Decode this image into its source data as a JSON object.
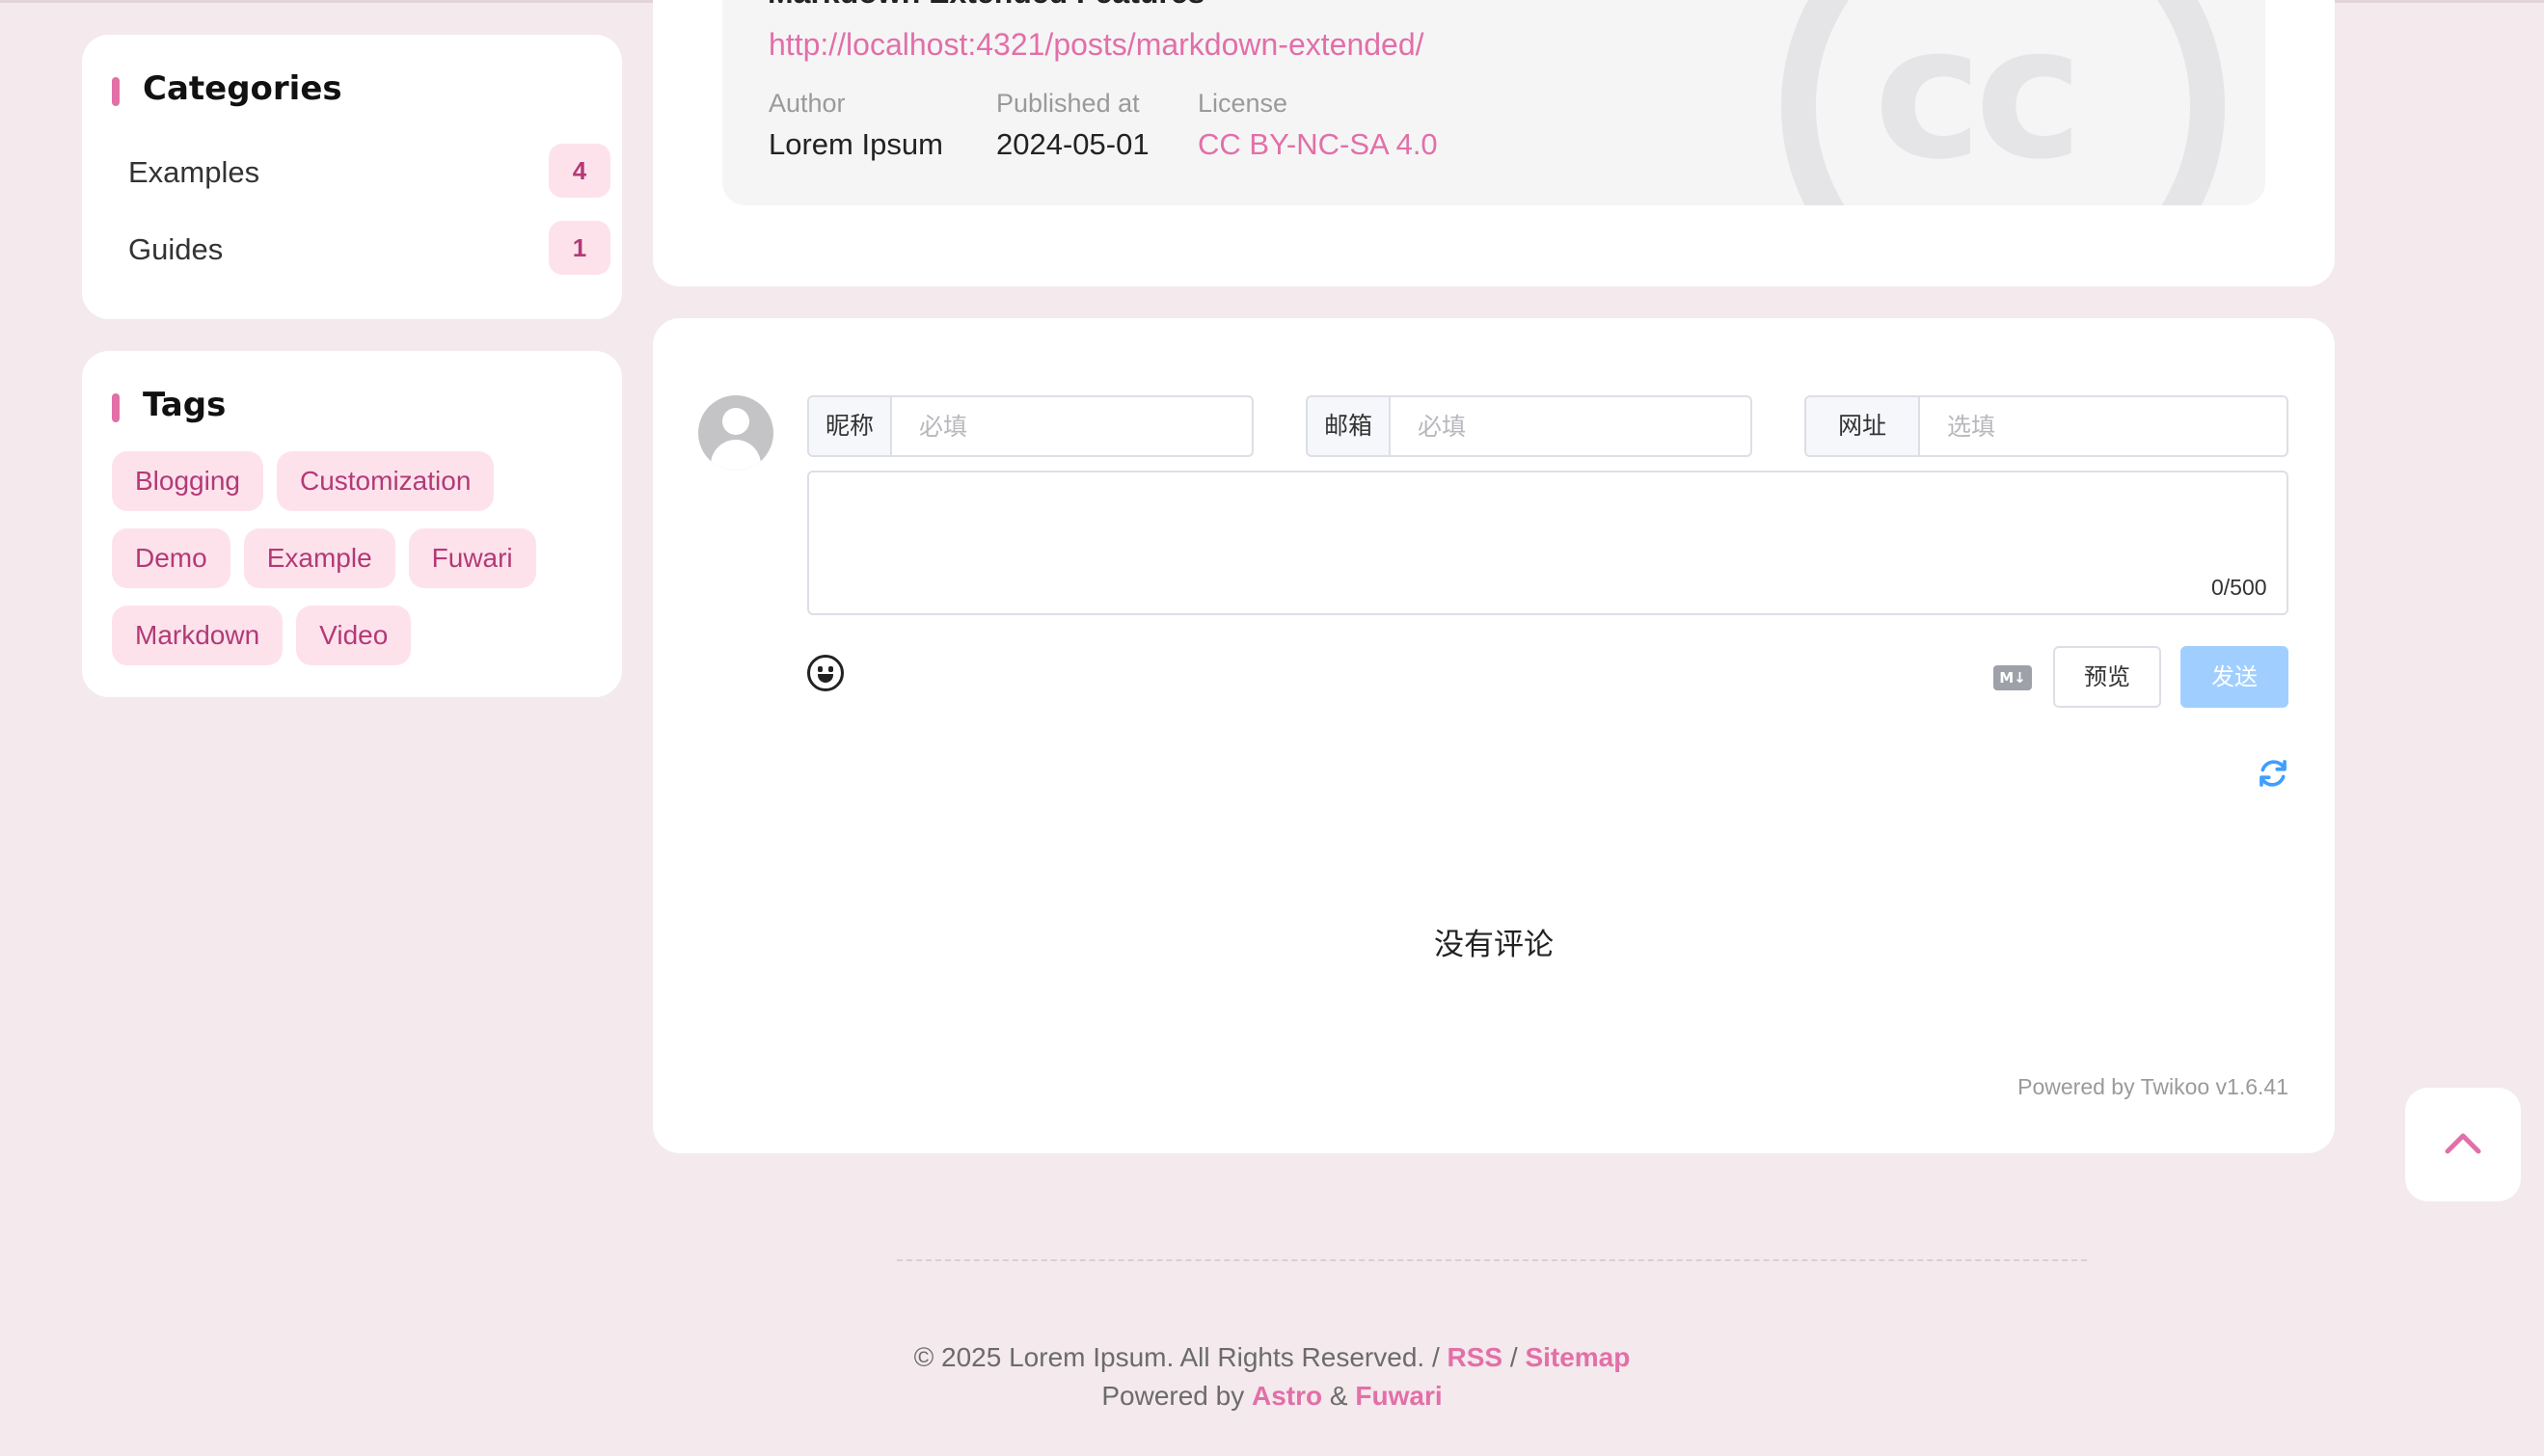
{
  "sidebar": {
    "categories": {
      "title": "Categories",
      "items": [
        {
          "label": "Examples",
          "count": "4"
        },
        {
          "label": "Guides",
          "count": "1"
        }
      ]
    },
    "tags": {
      "title": "Tags",
      "items": [
        "Blogging",
        "Customization",
        "Demo",
        "Example",
        "Fuwari",
        "Markdown",
        "Video"
      ]
    }
  },
  "license": {
    "post_title": "Markdown Extended Features",
    "post_url": "http://localhost:4321/posts/markdown-extended/",
    "author_label": "Author",
    "author": "Lorem Ipsum",
    "published_label": "Published at",
    "published": "2024-05-01",
    "license_label": "License",
    "license": "CC BY-NC-SA 4.0",
    "watermark_icon": "creative-commons-icon"
  },
  "comments": {
    "nick_label": "昵称",
    "nick_placeholder": "必填",
    "mail_label": "邮箱",
    "mail_placeholder": "必填",
    "link_label": "网址",
    "link_placeholder": "选填",
    "counter": "0/500",
    "markdown_badge": "M↓",
    "preview_label": "预览",
    "send_label": "发送",
    "empty_text": "没有评论",
    "powered_by": "Powered by Twikoo v1.6.41",
    "send_color": "#a0cfff",
    "refresh_color": "#409eff"
  },
  "footer": {
    "copyright": "© 2025 Lorem Ipsum. All Rights Reserved. /",
    "rss": "RSS",
    "slash": "/",
    "sitemap": "Sitemap",
    "powered_prefix": "Powered by",
    "astro": "Astro",
    "amp": "&",
    "fuwari": "Fuwari"
  },
  "theme": {
    "accent": "#e26fa8",
    "background": "#f4e9ed"
  }
}
